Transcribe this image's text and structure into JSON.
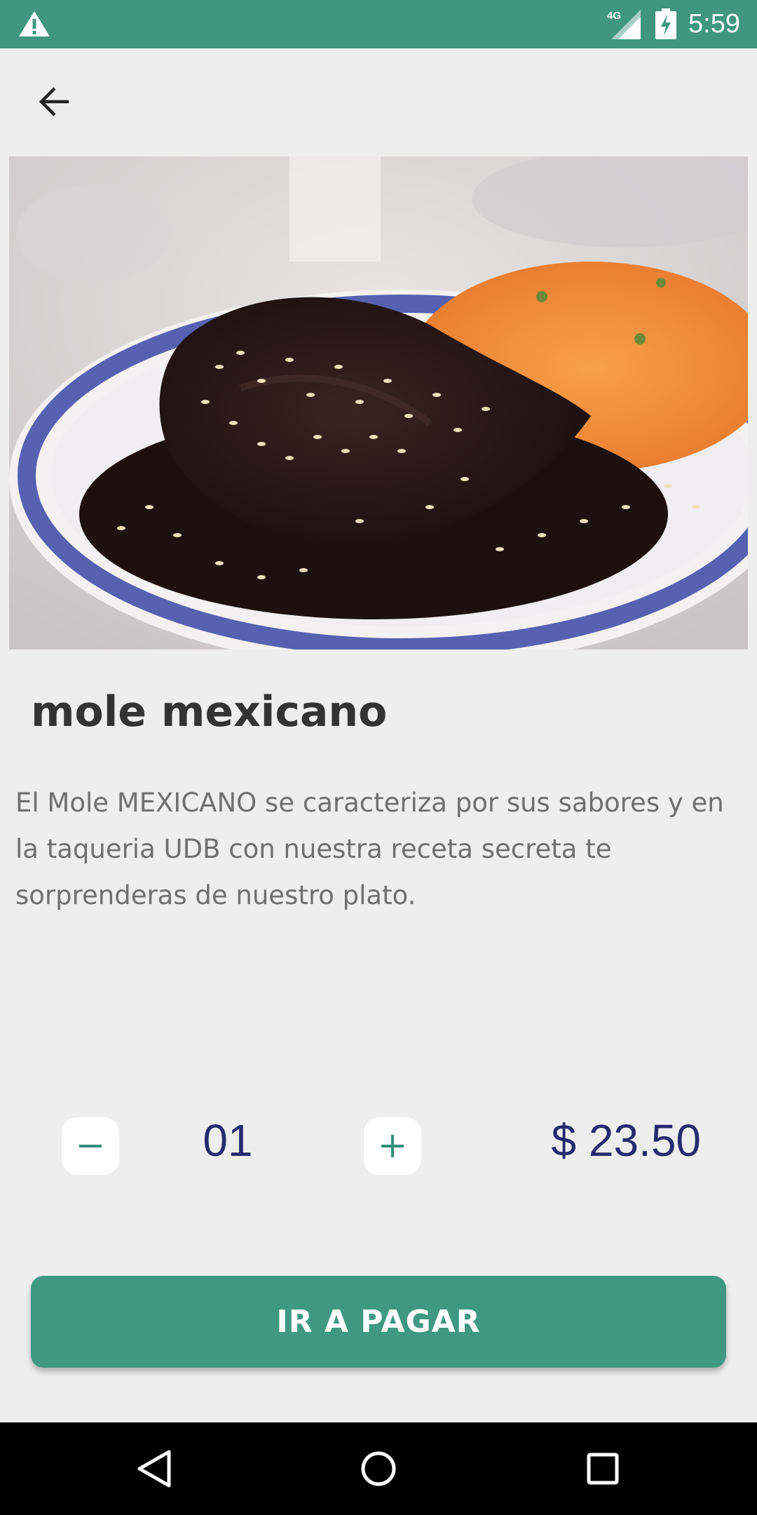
{
  "status_bar": {
    "time": "5:59",
    "network_label": "4G",
    "icons": [
      "warning-icon",
      "signal-icon",
      "battery-charging-icon"
    ],
    "color": "#40967f"
  },
  "app_bar": {
    "back_icon": "arrow-back-icon"
  },
  "hero_image": {
    "subject": "plate of mole with sesame seeds and rice"
  },
  "dish": {
    "title": "mole mexicano",
    "description": "El Mole MEXICANO se caracteriza por sus sabores y en la taqueria UDB con nuestra receta secreta te sorprenderas de nuestro plato."
  },
  "order": {
    "decrement_icon": "minus-icon",
    "quantity": "01",
    "increment_icon": "plus-icon",
    "price": "$ 23.50"
  },
  "pay_button": {
    "label": "IR A PAGAR",
    "color": "#3f9882"
  },
  "nav_bar": {
    "icons": [
      "nav-back-icon",
      "nav-home-icon",
      "nav-recents-icon"
    ]
  },
  "colors": {
    "accent": "#40967f",
    "text_primary": "#333333",
    "text_secondary": "#6f6f6f",
    "price_text": "#262a6e",
    "background": "#eeeeee"
  }
}
